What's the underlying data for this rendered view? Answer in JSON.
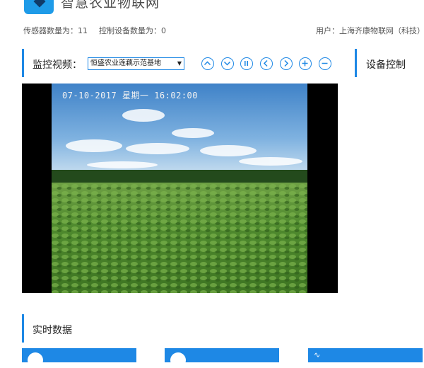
{
  "header": {
    "title": "智慧农业物联网",
    "sensor_count": "传感器数量为：11",
    "control_count": "控制设备数量为：0",
    "user": "用户：上海齐康物联网（科技）"
  },
  "monitor": {
    "label": "监控视频：",
    "camera_selected": "恒盛农业莲藕示范基地",
    "controls": [
      "zoom-up-icon",
      "zoom-down-icon",
      "pause-icon",
      "prev-icon",
      "next-icon",
      "zoom-in-icon",
      "zoom-out-icon"
    ],
    "overlay_time": "07-10-2017  星期一  16:02:00"
  },
  "device_control": {
    "label": "设备控制"
  },
  "realtime": {
    "label": "实时数据"
  },
  "colors": {
    "accent": "#1e88e5",
    "logo": "#1e9be8"
  }
}
